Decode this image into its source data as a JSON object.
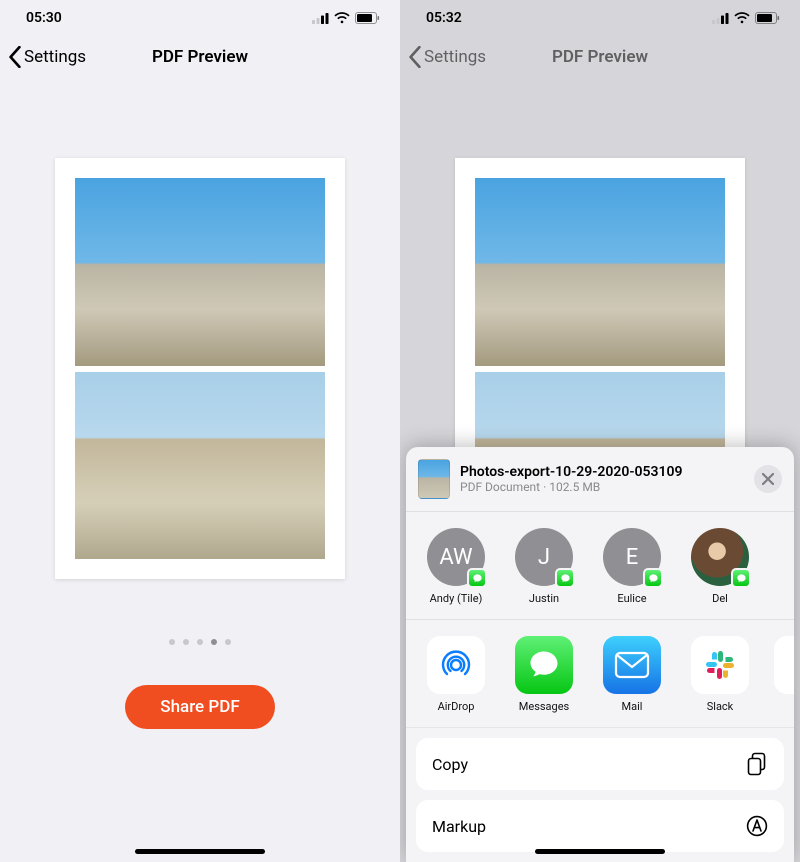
{
  "left": {
    "status": {
      "time": "05:30"
    },
    "nav": {
      "back": "Settings",
      "title": "PDF Preview"
    },
    "dots": {
      "count": 5,
      "active": 3
    },
    "share_button": "Share PDF"
  },
  "right": {
    "status": {
      "time": "05:32"
    },
    "nav": {
      "back": "Settings",
      "title": "PDF Preview"
    },
    "sheet": {
      "file_name": "Photos-export-10-29-2020-053109",
      "file_type": "PDF Document",
      "file_size": "102.5 MB",
      "contacts": [
        {
          "initials": "AW",
          "label": "Andy (Tile)"
        },
        {
          "initials": "J",
          "label": "Justin"
        },
        {
          "initials": "E",
          "label": "Eulice"
        },
        {
          "initials": "",
          "label": "Del",
          "photo": true
        }
      ],
      "apps": [
        {
          "label": "AirDrop",
          "key": "airdrop"
        },
        {
          "label": "Messages",
          "key": "messages"
        },
        {
          "label": "Mail",
          "key": "mail"
        },
        {
          "label": "Slack",
          "key": "slack"
        }
      ],
      "actions": [
        {
          "label": "Copy",
          "icon": "copy"
        },
        {
          "label": "Markup",
          "icon": "markup"
        }
      ]
    }
  }
}
